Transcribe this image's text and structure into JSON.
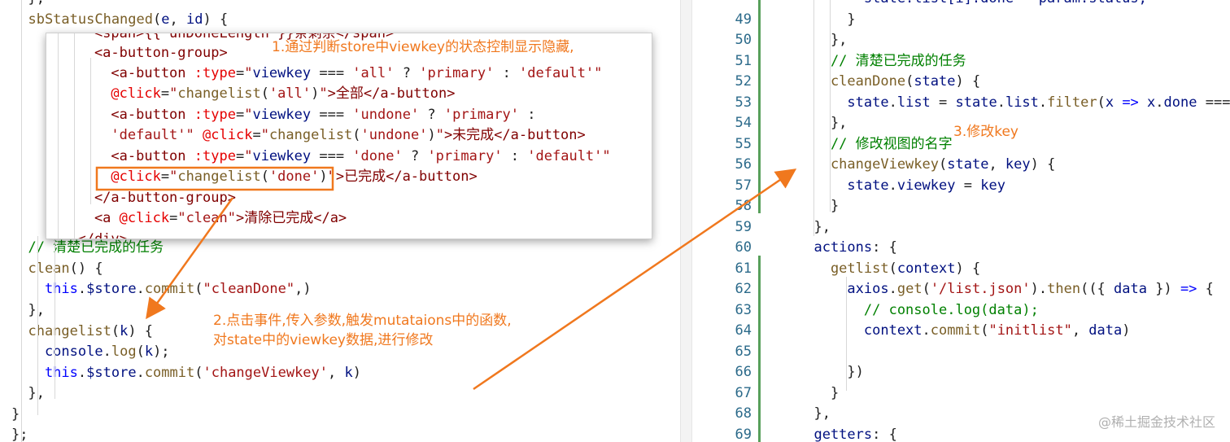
{
  "left": {
    "lines": [
      [
        {
          "t": "  },",
          "c": "pl"
        }
      ],
      [
        {
          "t": "  sbStatusChanged",
          "c": "fn"
        },
        {
          "t": "(",
          "c": "pl"
        },
        {
          "t": "e",
          "c": "var"
        },
        {
          "t": ", ",
          "c": "pl"
        },
        {
          "t": "id",
          "c": "var"
        },
        {
          "t": ") {",
          "c": "pl"
        }
      ],
      [],
      [],
      [],
      [],
      [],
      [],
      [],
      [],
      [],
      [],
      [
        {
          "t": "  // 清楚已完成的任务",
          "c": "cm"
        }
      ],
      [
        {
          "t": "  clean",
          "c": "fn"
        },
        {
          "t": "() {",
          "c": "pl"
        }
      ],
      [
        {
          "t": "    this",
          "c": "kw"
        },
        {
          "t": ".",
          "c": "pl"
        },
        {
          "t": "$store",
          "c": "var"
        },
        {
          "t": ".",
          "c": "pl"
        },
        {
          "t": "commit",
          "c": "fn"
        },
        {
          "t": "(",
          "c": "pl"
        },
        {
          "t": "\"cleanDone\"",
          "c": "str"
        },
        {
          "t": ",)",
          "c": "pl"
        }
      ],
      [
        {
          "t": "  },",
          "c": "pl"
        }
      ],
      [
        {
          "t": "  changelist",
          "c": "fn"
        },
        {
          "t": "(",
          "c": "pl"
        },
        {
          "t": "k",
          "c": "var"
        },
        {
          "t": ") {",
          "c": "pl"
        }
      ],
      [
        {
          "t": "    console",
          "c": "var"
        },
        {
          "t": ".",
          "c": "pl"
        },
        {
          "t": "log",
          "c": "fn"
        },
        {
          "t": "(",
          "c": "pl"
        },
        {
          "t": "k",
          "c": "var"
        },
        {
          "t": ");",
          "c": "pl"
        }
      ],
      [
        {
          "t": "    this",
          "c": "kw"
        },
        {
          "t": ".",
          "c": "pl"
        },
        {
          "t": "$store",
          "c": "var"
        },
        {
          "t": ".",
          "c": "pl"
        },
        {
          "t": "commit",
          "c": "fn"
        },
        {
          "t": "(",
          "c": "pl"
        },
        {
          "t": "'changeViewkey'",
          "c": "str"
        },
        {
          "t": ", ",
          "c": "pl"
        },
        {
          "t": "k",
          "c": "var"
        },
        {
          "t": ")",
          "c": "pl"
        }
      ],
      [
        {
          "t": "  },",
          "c": "pl"
        }
      ],
      [
        {
          "t": "}",
          "c": "pl"
        }
      ],
      [
        {
          "t": "};",
          "c": "pl"
        }
      ]
    ]
  },
  "peek": {
    "lines": [
      [
        {
          "t": "    <span>{{ unDoneLength }}条剩余</span>",
          "c": "tag"
        }
      ],
      [
        {
          "t": "    <a-button-group>",
          "c": "tag"
        }
      ],
      [
        {
          "t": "      <a-button ",
          "c": "tag"
        },
        {
          "t": ":type",
          "c": "attr"
        },
        {
          "t": "=",
          "c": "pl"
        },
        {
          "t": "\"",
          "c": "str"
        },
        {
          "t": "viewkey",
          "c": "var"
        },
        {
          "t": " === ",
          "c": "pl"
        },
        {
          "t": "'all'",
          "c": "str"
        },
        {
          "t": " ? ",
          "c": "pl"
        },
        {
          "t": "'primary'",
          "c": "str"
        },
        {
          "t": " : ",
          "c": "pl"
        },
        {
          "t": "'default'",
          "c": "str"
        },
        {
          "t": "\"",
          "c": "str"
        }
      ],
      [
        {
          "t": "      @click",
          "c": "attr"
        },
        {
          "t": "=",
          "c": "pl"
        },
        {
          "t": "\"",
          "c": "str"
        },
        {
          "t": "changelist",
          "c": "fn"
        },
        {
          "t": "(",
          "c": "pl"
        },
        {
          "t": "'all'",
          "c": "str"
        },
        {
          "t": ")",
          "c": "pl"
        },
        {
          "t": "\"",
          "c": "str"
        },
        {
          "t": ">全部</a-button>",
          "c": "tag"
        }
      ],
      [
        {
          "t": "      <a-button ",
          "c": "tag"
        },
        {
          "t": ":type",
          "c": "attr"
        },
        {
          "t": "=",
          "c": "pl"
        },
        {
          "t": "\"",
          "c": "str"
        },
        {
          "t": "viewkey",
          "c": "var"
        },
        {
          "t": " === ",
          "c": "pl"
        },
        {
          "t": "'undone'",
          "c": "str"
        },
        {
          "t": " ? ",
          "c": "pl"
        },
        {
          "t": "'primary'",
          "c": "str"
        },
        {
          "t": " :",
          "c": "pl"
        }
      ],
      [
        {
          "t": "      'default'",
          "c": "str"
        },
        {
          "t": "\"",
          "c": "str"
        },
        {
          "t": " @click",
          "c": "attr"
        },
        {
          "t": "=",
          "c": "pl"
        },
        {
          "t": "\"",
          "c": "str"
        },
        {
          "t": "changelist",
          "c": "fn"
        },
        {
          "t": "(",
          "c": "pl"
        },
        {
          "t": "'undone'",
          "c": "str"
        },
        {
          "t": ")",
          "c": "pl"
        },
        {
          "t": "\"",
          "c": "str"
        },
        {
          "t": ">未完成</a-button>",
          "c": "tag"
        }
      ],
      [
        {
          "t": "      <a-button ",
          "c": "tag"
        },
        {
          "t": ":type",
          "c": "attr"
        },
        {
          "t": "=",
          "c": "pl"
        },
        {
          "t": "\"",
          "c": "str"
        },
        {
          "t": "viewkey",
          "c": "var"
        },
        {
          "t": " === ",
          "c": "pl"
        },
        {
          "t": "'done'",
          "c": "str"
        },
        {
          "t": " ? ",
          "c": "pl"
        },
        {
          "t": "'primary'",
          "c": "str"
        },
        {
          "t": " : ",
          "c": "pl"
        },
        {
          "t": "'default'",
          "c": "str"
        },
        {
          "t": "\"",
          "c": "str"
        }
      ],
      [
        {
          "t": "      @click",
          "c": "attr"
        },
        {
          "t": "=",
          "c": "pl"
        },
        {
          "t": "\"",
          "c": "str"
        },
        {
          "t": "changelist",
          "c": "fn"
        },
        {
          "t": "(",
          "c": "pl"
        },
        {
          "t": "'done'",
          "c": "str"
        },
        {
          "t": ")",
          "c": "pl"
        },
        {
          "t": "\"",
          "c": "str"
        },
        {
          "t": ">已完成</a-button>",
          "c": "tag"
        }
      ],
      [
        {
          "t": "    </a-button-group>",
          "c": "tag"
        }
      ],
      [
        {
          "t": "    <a ",
          "c": "tag"
        },
        {
          "t": "@click",
          "c": "attr"
        },
        {
          "t": "=",
          "c": "pl"
        },
        {
          "t": "\"clean\"",
          "c": "str"
        },
        {
          "t": ">清除已完成</a>",
          "c": "tag"
        }
      ],
      [
        {
          "t": "  </div>",
          "c": "tag"
        }
      ]
    ]
  },
  "right": {
    "lines": [
      {
        "n": "",
        "seg": [
          {
            "t": "        state.list[i].done = param.status;",
            "c": "var"
          }
        ]
      },
      {
        "n": "49",
        "seg": [
          {
            "t": "      }",
            "c": "pl"
          }
        ]
      },
      {
        "n": "50",
        "seg": [
          {
            "t": "    },",
            "c": "pl"
          }
        ]
      },
      {
        "n": "51",
        "seg": [
          {
            "t": "    // 清楚已完成的任务",
            "c": "cm"
          }
        ]
      },
      {
        "n": "52",
        "seg": [
          {
            "t": "    cleanDone",
            "c": "fn"
          },
          {
            "t": "(",
            "c": "pl"
          },
          {
            "t": "state",
            "c": "var"
          },
          {
            "t": ") {",
            "c": "pl"
          }
        ]
      },
      {
        "n": "53",
        "seg": [
          {
            "t": "      state",
            "c": "var"
          },
          {
            "t": ".",
            "c": "pl"
          },
          {
            "t": "list",
            "c": "var"
          },
          {
            "t": " = ",
            "c": "pl"
          },
          {
            "t": "state",
            "c": "var"
          },
          {
            "t": ".",
            "c": "pl"
          },
          {
            "t": "list",
            "c": "var"
          },
          {
            "t": ".",
            "c": "pl"
          },
          {
            "t": "filter",
            "c": "fn"
          },
          {
            "t": "(",
            "c": "pl"
          },
          {
            "t": "x",
            "c": "var"
          },
          {
            "t": " => ",
            "c": "kw"
          },
          {
            "t": "x",
            "c": "var"
          },
          {
            "t": ".",
            "c": "pl"
          },
          {
            "t": "done",
            "c": "var"
          },
          {
            "t": " === f",
            "c": "pl"
          }
        ]
      },
      {
        "n": "54",
        "seg": [
          {
            "t": "    },",
            "c": "pl"
          }
        ]
      },
      {
        "n": "55",
        "seg": [
          {
            "t": "    // 修改视图的名字",
            "c": "cm"
          }
        ]
      },
      {
        "n": "56",
        "seg": [
          {
            "t": "    changeViewkey",
            "c": "fn"
          },
          {
            "t": "(",
            "c": "pl"
          },
          {
            "t": "state",
            "c": "var"
          },
          {
            "t": ", ",
            "c": "pl"
          },
          {
            "t": "key",
            "c": "var"
          },
          {
            "t": ") {",
            "c": "pl"
          }
        ]
      },
      {
        "n": "57",
        "seg": [
          {
            "t": "      state",
            "c": "var"
          },
          {
            "t": ".",
            "c": "pl"
          },
          {
            "t": "viewkey",
            "c": "var"
          },
          {
            "t": " = ",
            "c": "pl"
          },
          {
            "t": "key",
            "c": "var"
          }
        ]
      },
      {
        "n": "58",
        "seg": [
          {
            "t": "    }",
            "c": "pl"
          }
        ]
      },
      {
        "n": "59",
        "seg": [
          {
            "t": "  },",
            "c": "pl"
          }
        ]
      },
      {
        "n": "60",
        "seg": [
          {
            "t": "  actions",
            "c": "var"
          },
          {
            "t": ": {",
            "c": "pl"
          }
        ]
      },
      {
        "n": "61",
        "seg": [
          {
            "t": "    getlist",
            "c": "fn"
          },
          {
            "t": "(",
            "c": "pl"
          },
          {
            "t": "context",
            "c": "var"
          },
          {
            "t": ") {",
            "c": "pl"
          }
        ]
      },
      {
        "n": "62",
        "seg": [
          {
            "t": "      axios",
            "c": "var"
          },
          {
            "t": ".",
            "c": "pl"
          },
          {
            "t": "get",
            "c": "fn"
          },
          {
            "t": "(",
            "c": "pl"
          },
          {
            "t": "'/list.json'",
            "c": "str"
          },
          {
            "t": ").",
            "c": "pl"
          },
          {
            "t": "then",
            "c": "fn"
          },
          {
            "t": "(({ ",
            "c": "pl"
          },
          {
            "t": "data",
            "c": "var"
          },
          {
            "t": " }) ",
            "c": "pl"
          },
          {
            "t": "=>",
            "c": "kw"
          },
          {
            "t": " {",
            "c": "pl"
          }
        ]
      },
      {
        "n": "63",
        "seg": [
          {
            "t": "        // console.log(data);",
            "c": "cm"
          }
        ]
      },
      {
        "n": "64",
        "seg": [
          {
            "t": "        context",
            "c": "var"
          },
          {
            "t": ".",
            "c": "pl"
          },
          {
            "t": "commit",
            "c": "fn"
          },
          {
            "t": "(",
            "c": "pl"
          },
          {
            "t": "\"initlist\"",
            "c": "str"
          },
          {
            "t": ", ",
            "c": "pl"
          },
          {
            "t": "data",
            "c": "var"
          },
          {
            "t": ")",
            "c": "pl"
          }
        ]
      },
      {
        "n": "65",
        "seg": []
      },
      {
        "n": "66",
        "seg": [
          {
            "t": "      })",
            "c": "pl"
          }
        ]
      },
      {
        "n": "67",
        "seg": [
          {
            "t": "    }",
            "c": "pl"
          }
        ]
      },
      {
        "n": "68",
        "seg": [
          {
            "t": "  },",
            "c": "pl"
          }
        ]
      },
      {
        "n": "69",
        "seg": [
          {
            "t": "  getters",
            "c": "var"
          },
          {
            "t": ": {",
            "c": "pl"
          }
        ]
      }
    ]
  },
  "annotations": {
    "a1": "1.通过判断store中viewkey的状态控制显示隐藏,",
    "a2_line1": "2.点击事件,传入参数,触发mutataions中的函数,",
    "a2_line2": "对state中的viewkey数据,进行修改",
    "a3": "3.修改key"
  },
  "watermark": "@稀土掘金技术社区",
  "colors": {
    "annotation": "#f0781e",
    "accent_gutter": "#58a05b"
  }
}
